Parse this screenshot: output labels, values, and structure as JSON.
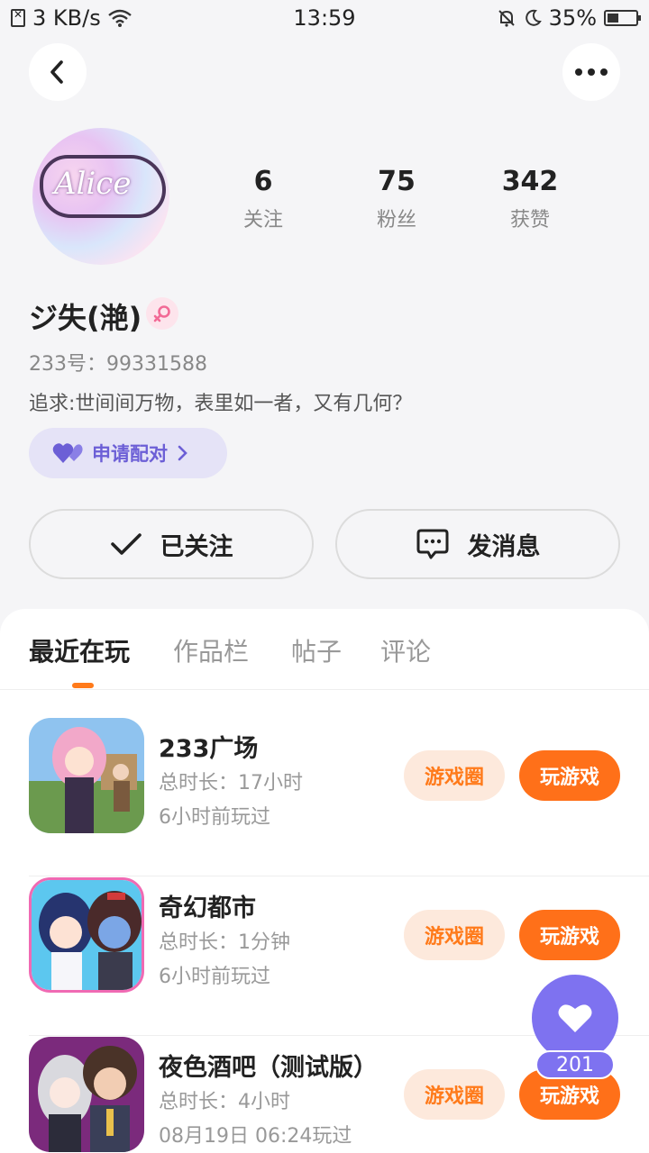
{
  "status_bar": {
    "speed": "3 KB/s",
    "time": "13:59",
    "battery": "35%",
    "battery_level": 0.35
  },
  "profile": {
    "stats": [
      {
        "value": "6",
        "label": "关注"
      },
      {
        "value": "75",
        "label": "粉丝"
      },
      {
        "value": "342",
        "label": "获赞"
      }
    ],
    "name": "ジ失(滟)",
    "gender": "female",
    "uid": "233号：99331588",
    "bio": "追求:世间间万物，表里如一者，又有几何？",
    "pair_label": "申请配对",
    "follow_label": "已关注",
    "message_label": "发消息"
  },
  "tabs": [
    {
      "label": "最近在玩",
      "active": true
    },
    {
      "label": "作品栏",
      "active": false
    },
    {
      "label": "帖子",
      "active": false
    },
    {
      "label": "评论",
      "active": false
    }
  ],
  "games": [
    {
      "title": "233广场",
      "duration": "总时长：17小时",
      "last_played": "6小时前玩过",
      "circle_label": "游戏圈",
      "play_label": "玩游戏"
    },
    {
      "title": "奇幻都市",
      "duration": "总时长：1分钟",
      "last_played": "6小时前玩过",
      "circle_label": "游戏圈",
      "play_label": "玩游戏"
    },
    {
      "title": "夜色酒吧（测试版）",
      "duration": "总时长：4小时",
      "last_played": "08月19日 06:24玩过",
      "circle_label": "游戏圈",
      "play_label": "玩游戏"
    }
  ],
  "like_fab": {
    "count": "201"
  },
  "colors": {
    "accent_orange": "#ff7019",
    "accent_purple": "#7e72f0",
    "pair_bg": "#e5e3f7"
  }
}
